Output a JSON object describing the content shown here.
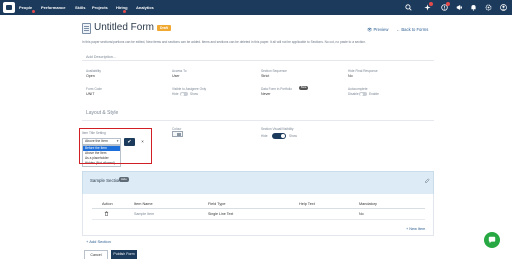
{
  "nav": {
    "items": [
      "People",
      "Performance",
      "Skills",
      "Projects",
      "Hiring",
      "Analytics"
    ],
    "icons": [
      "logo-icon",
      "search-icon",
      "sparkle-icon",
      "alert-icon",
      "megaphone-icon",
      "bell-icon",
      "settings-icon",
      "user-icon"
    ]
  },
  "header": {
    "title": "Untitled Form",
    "status": "Draft",
    "preview": "Preview",
    "back": "Back to Forms",
    "subtitle": "In this paper sections/portions can be edited, New items and sections can be added. Items and sections can be deleted in this paper. It all will not be applicable to Sections. No cut, no paste to a section."
  },
  "description_placeholder": "Add Description...",
  "settings": {
    "availability": {
      "label": "Availability",
      "value": "Open"
    },
    "access_to": {
      "label": "Access To",
      "value": "User"
    },
    "section_sequence": {
      "label": "Section Sequence",
      "value": "Strict"
    },
    "hide_final_response": {
      "label": "Hide Final Response",
      "value": "No"
    },
    "form_code": {
      "label": "Form Code",
      "value": "UNIT"
    },
    "visible_to_assignee": {
      "label": "Visible to Assignee Only",
      "off": "Hide",
      "on": "Show"
    },
    "data_form_portfolio": {
      "label": "Data Form in Portfolio",
      "badge": "Beta",
      "value": "Never"
    },
    "autocomplete": {
      "label": "Autocomplete",
      "off": "Disable",
      "on": "Enable"
    }
  },
  "layout_style": {
    "title": "Layout & Style",
    "item_title_setting": {
      "label": "Item Title Setting",
      "selected": "Above the Item",
      "options": [
        "Before the Item",
        "Above the Item",
        "As a placeholder",
        "Hidden (Not allowed)"
      ],
      "highlighted": "Before the Item",
      "confirm": "✔",
      "cancel": "×"
    },
    "colour": {
      "label": "Colour"
    },
    "section_visibility": {
      "label": "Section Visual/Visibility",
      "off": "Hide",
      "on": "Show"
    }
  },
  "section": {
    "title": "Sample Section",
    "badge": "Hide",
    "columns": [
      "Action",
      "Item Name",
      "Field Type",
      "Help Text",
      "Mandatory"
    ],
    "rows": [
      {
        "item_name": "Sample Item",
        "field_type": "Single Line Text",
        "help_text": "",
        "mandatory": "No"
      }
    ],
    "new_item": "+ New Item"
  },
  "add_section": "+ Add Section",
  "footer": {
    "cancel": "Cancel",
    "publish": "Publish Form"
  },
  "colors": {
    "navy": "#1b3a5c",
    "section_bg": "#dcebf5",
    "highlight": "#d11f26",
    "chat": "#27a843"
  }
}
